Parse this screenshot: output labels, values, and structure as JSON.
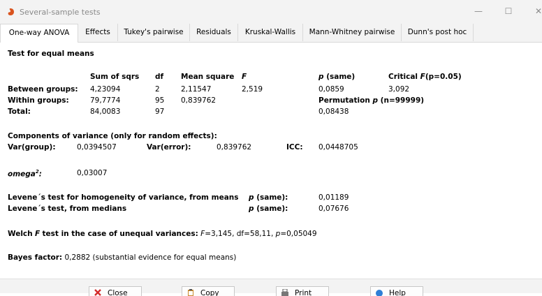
{
  "window": {
    "title": "Several-sample tests",
    "controls": {
      "minimize": "—",
      "maximize": "☐",
      "close": "✕"
    }
  },
  "tabs": [
    {
      "label": "One-way ANOVA",
      "active": true
    },
    {
      "label": "Effects"
    },
    {
      "label": "Tukey's pairwise"
    },
    {
      "label": "Residuals"
    },
    {
      "label": "Kruskal-Wallis"
    },
    {
      "label": "Mann-Whitney pairwise"
    },
    {
      "label": "Dunn's post hoc"
    }
  ],
  "anova": {
    "heading": "Test for equal means",
    "col_sum": "Sum of sqrs",
    "col_df": "df",
    "col_mean": "Mean square",
    "col_f": "F",
    "col_p": "(same)",
    "col_p_sym": "p",
    "col_crit": "Critical",
    "col_crit_f": "F",
    "col_crit_suffix": "(p=0.05)",
    "rows": [
      {
        "label": "Between groups:",
        "sum": "4,23094",
        "df": "2",
        "mean": "2,11547",
        "f": "2,519",
        "p": "0,0859",
        "crit": "3,092"
      },
      {
        "label": "Within groups:",
        "sum": "79,7774",
        "df": "95",
        "mean": "0,839762"
      },
      {
        "label": "Total:",
        "sum": "84,0083",
        "df": "97",
        "p": "0,08438"
      }
    ],
    "perm_prefix": "Permutation",
    "perm_p": "p",
    "perm_suffix": "(n=99999)"
  },
  "variance": {
    "heading": "Components of variance (only for random effects):",
    "var_group_label": "Var(group):",
    "var_group": "0,0394507",
    "var_error_label": "Var(error):",
    "var_error": "0,839762",
    "icc_label": "ICC:",
    "icc": "0,0448705"
  },
  "omega": {
    "label": "omega",
    "sup": "2",
    "colon": ":",
    "value": "0,03007"
  },
  "levene": {
    "means_label": "Levene´s test for homogeneity of variance, from means",
    "means_p_label": "(same):",
    "p_sym": "p",
    "means_p": "0,01189",
    "medians_label": "Levene´s test, from medians",
    "medians_p_label": "(same):",
    "medians_p": "0,07676"
  },
  "welch": {
    "bold": "Welch",
    "f": "F",
    "bold2": "test in the case of unequal variances:",
    "rest_f": "F",
    "rest1": "=3,145, df=58,11,",
    "rest_p": "p",
    "rest2": "=0,05049"
  },
  "bayes": {
    "label": "Bayes factor:",
    "text": "0,2882 (substantial evidence for equal means)"
  },
  "footer": {
    "buttons": [
      {
        "label": "Close"
      },
      {
        "label": "Copy"
      },
      {
        "label": "Print"
      },
      {
        "label": "Help"
      }
    ]
  },
  "colors": {
    "chrome": "#f3f3f3",
    "border": "#d9d9d9",
    "close_icon": "#d42b2b",
    "help_icon": "#2f7fd6"
  }
}
